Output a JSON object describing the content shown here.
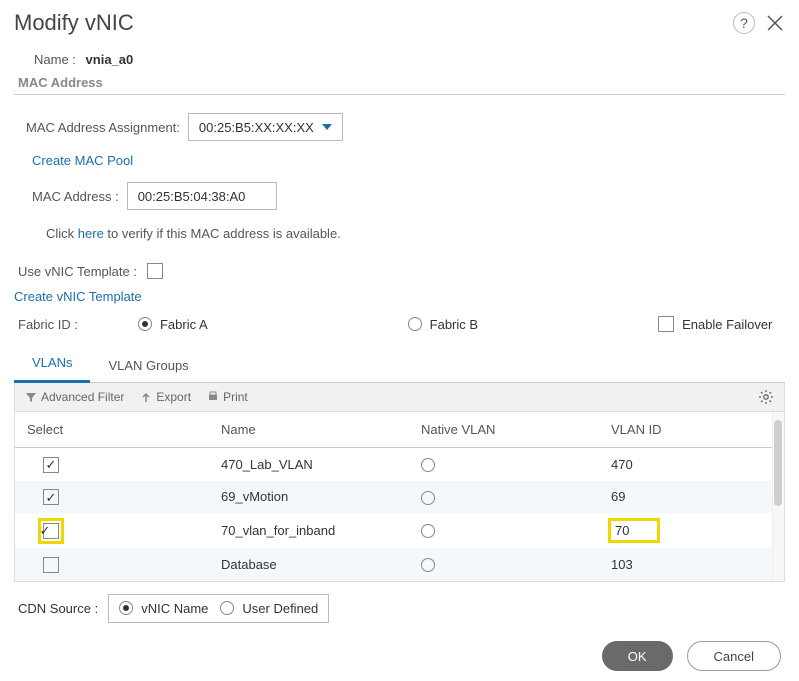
{
  "dialog": {
    "title": "Modify vNIC",
    "name_label": "Name :",
    "name_value": "vnia_a0",
    "mac_section": "MAC Address",
    "mac_assignment_label": "MAC Address Assignment:",
    "mac_assignment_value": "00:25:B5:XX:XX:XX",
    "create_mac_pool": "Create MAC Pool",
    "mac_address_label": "MAC Address :",
    "mac_address_value": "00:25:B5:04:38:A0",
    "verify_prefix": "Click ",
    "verify_link": "here",
    "verify_suffix": " to verify if this MAC address is available.",
    "use_template_label": "Use vNIC Template :",
    "create_template": "Create vNIC Template",
    "fabric_label": "Fabric ID :",
    "fabric_a": "Fabric A",
    "fabric_b": "Fabric B",
    "enable_failover": "Enable Failover",
    "tabs": {
      "vlans": "VLANs",
      "groups": "VLAN Groups"
    },
    "toolbar": {
      "filter": "Advanced Filter",
      "export": "Export",
      "print": "Print"
    },
    "columns": {
      "select": "Select",
      "name": "Name",
      "native": "Native VLAN",
      "id": "VLAN ID"
    },
    "rows": [
      {
        "checked": true,
        "name": "470_Lab_VLAN",
        "id": "470",
        "hl": false
      },
      {
        "checked": true,
        "name": "69_vMotion",
        "id": "69",
        "hl": false
      },
      {
        "checked": true,
        "name": "70_vlan_for_inband",
        "id": "70",
        "hl": true
      },
      {
        "checked": false,
        "name": "Database",
        "id": "103",
        "hl": false
      }
    ],
    "cdn_label": "CDN Source :",
    "cdn_opt1": "vNIC Name",
    "cdn_opt2": "User Defined",
    "ok": "OK",
    "cancel": "Cancel"
  }
}
